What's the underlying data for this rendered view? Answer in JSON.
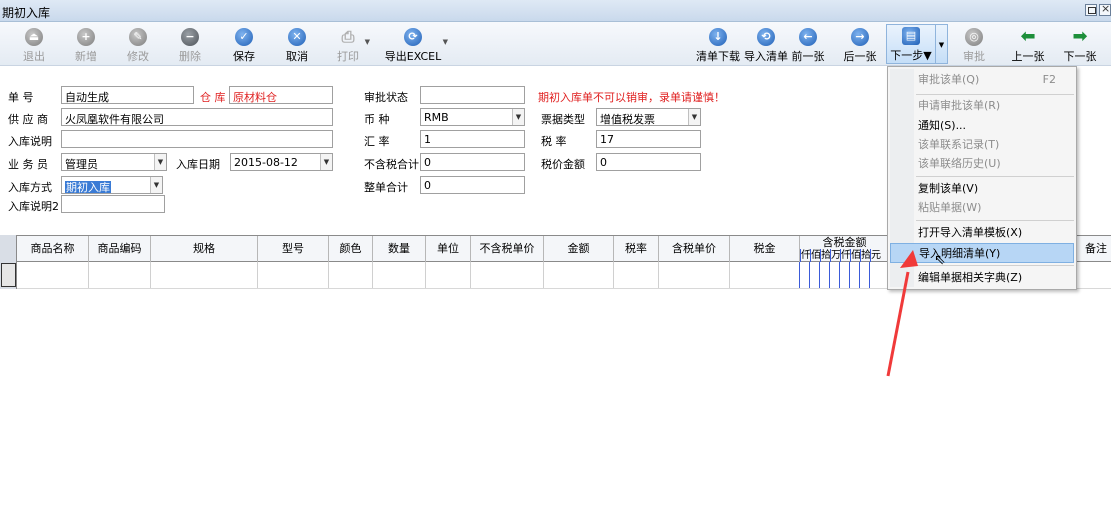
{
  "window": {
    "title": "期初入库"
  },
  "toolbar": {
    "buttons": [
      {
        "label": "退出",
        "icon": "exit-icon",
        "enabled": false
      },
      {
        "label": "新增",
        "icon": "add-icon",
        "enabled": false
      },
      {
        "label": "修改",
        "icon": "edit-icon",
        "enabled": false
      },
      {
        "label": "删除",
        "icon": "delete-icon",
        "enabled": false
      },
      {
        "label": "保存",
        "icon": "save-icon",
        "enabled": true
      },
      {
        "label": "取消",
        "icon": "cancel-icon",
        "enabled": true
      },
      {
        "label": "打印",
        "icon": "printer-icon",
        "enabled": false
      },
      {
        "label": "导出EXCEL",
        "icon": "export-excel-icon",
        "enabled": true
      },
      {
        "label": "清单下载",
        "icon": "download-icon",
        "enabled": true
      },
      {
        "label": "导入清单",
        "icon": "import-icon",
        "enabled": true
      },
      {
        "label": "前一张",
        "icon": "arrow-left-icon",
        "enabled": true
      },
      {
        "label": "后一张",
        "icon": "arrow-right-icon",
        "enabled": true
      },
      {
        "label": "下一步▼",
        "icon": "next-step-icon",
        "enabled": true
      },
      {
        "label": "审批",
        "icon": "approve-icon",
        "enabled": false
      },
      {
        "label": "上一张",
        "icon": "prev-arrow-icon",
        "enabled": true
      },
      {
        "label": "下一张",
        "icon": "next-arrow-icon",
        "enabled": true
      }
    ]
  },
  "form": {
    "doc_no_label": "单    号",
    "doc_no_value": "自动生成",
    "warehouse_label": "仓 库",
    "warehouse_value": "原材料仓",
    "supplier_label": "供 应 商",
    "supplier_value": "火凤凰软件有限公司",
    "note_label": "入库说明",
    "note_value": "",
    "salesman_label": "业 务 员",
    "salesman_value": "管理员",
    "date_label": "入库日期",
    "date_value": "2015-08-12",
    "method_label": "入库方式",
    "method_value": "期初入库",
    "note2_label": "入库说明2",
    "note2_value": "",
    "approval_label": "审批状态",
    "approval_value": "",
    "currency_label": "币    种",
    "currency_value": "RMB",
    "rate_label": "汇    率",
    "rate_value": "1",
    "untaxed_total_label": "不含税合计",
    "untaxed_total_value": "0",
    "whole_total_label": "整单合计",
    "whole_total_value": "0",
    "warning": "期初入库单不可以销审，录单请谨慎！",
    "invoice_type_label": "票据类型",
    "invoice_type_value": "增值税发票",
    "tax_rate_label": "税    率",
    "tax_rate_value": "17",
    "tax_amount_label": "税价金额",
    "tax_amount_value": "0"
  },
  "grid": {
    "columns": [
      "商品名称",
      "商品编码",
      "规格",
      "型号",
      "颜色",
      "数量",
      "单位",
      "不含税单价",
      "金额",
      "税率",
      "含税单价",
      "税金"
    ],
    "amount_header": "含税金额",
    "amount_digits": [
      "仟",
      "佰",
      "拾",
      "万",
      "仟",
      "佰",
      "拾",
      "元"
    ],
    "last_column": "备注"
  },
  "menu": {
    "items": [
      {
        "label": "审批该单(Q)",
        "shortcut": "F2",
        "enabled": false
      },
      {
        "label": "申请审批该单(R)",
        "shortcut": "",
        "enabled": false
      },
      {
        "label": "通知(S)...",
        "shortcut": "",
        "enabled": true
      },
      {
        "label": "该单联系记录(T)",
        "shortcut": "",
        "enabled": false
      },
      {
        "label": "该单联络历史(U)",
        "shortcut": "",
        "enabled": false
      },
      {
        "label": "复制该单(V)",
        "shortcut": "",
        "enabled": true
      },
      {
        "label": "粘贴单据(W)",
        "shortcut": "",
        "enabled": false
      },
      {
        "label": "打开导入清单模板(X)",
        "shortcut": "",
        "enabled": true
      },
      {
        "label": "导入明细清单(Y)",
        "shortcut": "",
        "enabled": true,
        "highlighted": true
      },
      {
        "label": "编辑单据相关字典(Z)",
        "shortcut": "",
        "enabled": true
      }
    ]
  },
  "colors": {
    "accent": "#3a7bd5",
    "warning": "#e02020",
    "annotation_arrow": "#f03a3a",
    "menu_highlight": "#b7d6f5"
  }
}
